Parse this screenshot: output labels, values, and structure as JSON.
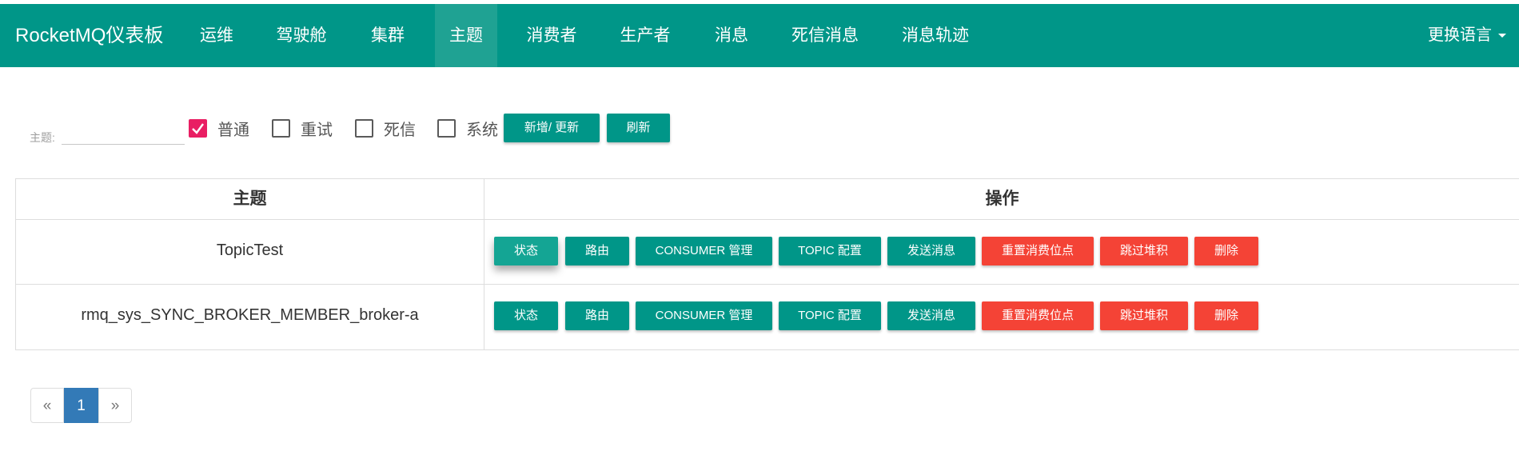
{
  "navbar": {
    "brand": "RocketMQ仪表板",
    "items": [
      {
        "label": "运维"
      },
      {
        "label": "驾驶舱"
      },
      {
        "label": "集群"
      },
      {
        "label": "主题",
        "active": true
      },
      {
        "label": "消费者"
      },
      {
        "label": "生产者"
      },
      {
        "label": "消息"
      },
      {
        "label": "死信消息"
      },
      {
        "label": "消息轨迹"
      }
    ],
    "language": "更换语言"
  },
  "filter": {
    "topic_label": "主题:",
    "topic_value": "",
    "checkboxes": [
      {
        "label": "普通",
        "checked": true
      },
      {
        "label": "重试",
        "checked": false
      },
      {
        "label": "死信",
        "checked": false
      },
      {
        "label": "系统",
        "checked": false
      }
    ],
    "add_update_button": "新增/ 更新",
    "refresh_button": "刷新"
  },
  "table": {
    "headers": {
      "topic": "主题",
      "operation": "操作"
    },
    "action_labels": {
      "status": "状态",
      "route": "路由",
      "consumer_manage": "CONSUMER 管理",
      "topic_config": "TOPIC 配置",
      "send_message": "发送消息",
      "reset_offset": "重置消费位点",
      "skip_accumulate": "跳过堆积",
      "delete": "删除"
    },
    "rows": [
      {
        "topic": "TopicTest"
      },
      {
        "topic": "rmq_sys_SYNC_BROKER_MEMBER_broker-a"
      }
    ]
  },
  "pagination": {
    "prev": "«",
    "current": "1",
    "next": "»"
  },
  "colors": {
    "primary": "#009688",
    "danger": "#f44336",
    "checked": "#e91e63",
    "page_active": "#337ab7"
  }
}
